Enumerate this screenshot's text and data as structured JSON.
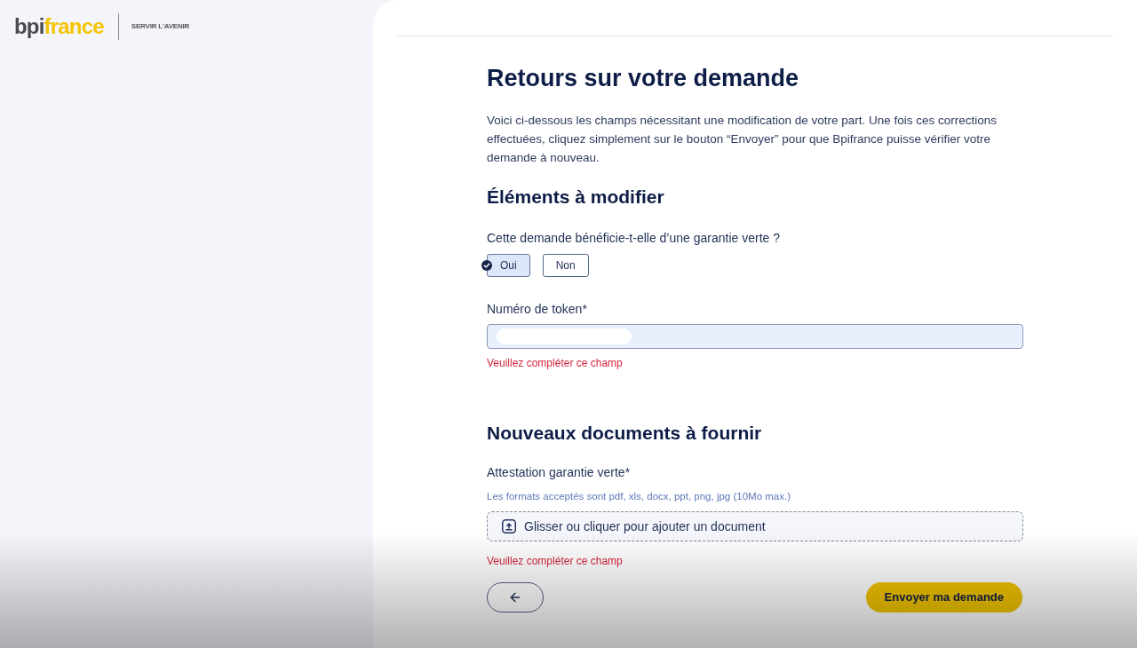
{
  "header": {
    "logo": {
      "part_1": "bpi",
      "part_2": "france"
    },
    "tagline": "SERVIR L'AVENIR"
  },
  "form": {
    "title": "Retours sur votre demande",
    "intro": "Voici ci-dessous les champs nécessitant une modification de votre part. Une fois ces corrections effectuées, cliquez simplement sur le bouton “Envoyer” pour que Bpifrance puisse vérifier votre demande à nouveau.",
    "sections": [
      {
        "heading": "Éléments à modifier",
        "fields": [
          {
            "kind": "choice",
            "label": "Cette demande bénéficie-t-elle d’une garantie verte ?",
            "options": [
              {
                "label": "Oui",
                "selected": true
              },
              {
                "label": "Non",
                "selected": false
              }
            ]
          },
          {
            "kind": "text",
            "label": "Numéro de token*",
            "redacted": true,
            "error": "Veuillez compléter ce champ"
          }
        ]
      },
      {
        "heading": "Nouveaux documents à fournir",
        "fields": [
          {
            "kind": "file",
            "label": "Attestation garantie verte*",
            "hint": "Les formats acceptés sont pdf, xls, docx, ppt, png, jpg (10Mo max.)",
            "placeholder": "Glisser ou cliquer pour ajouter un document",
            "error": "Veuillez compléter ce champ"
          }
        ]
      }
    ],
    "actions": {
      "submit": "Envoyer ma demande"
    }
  }
}
